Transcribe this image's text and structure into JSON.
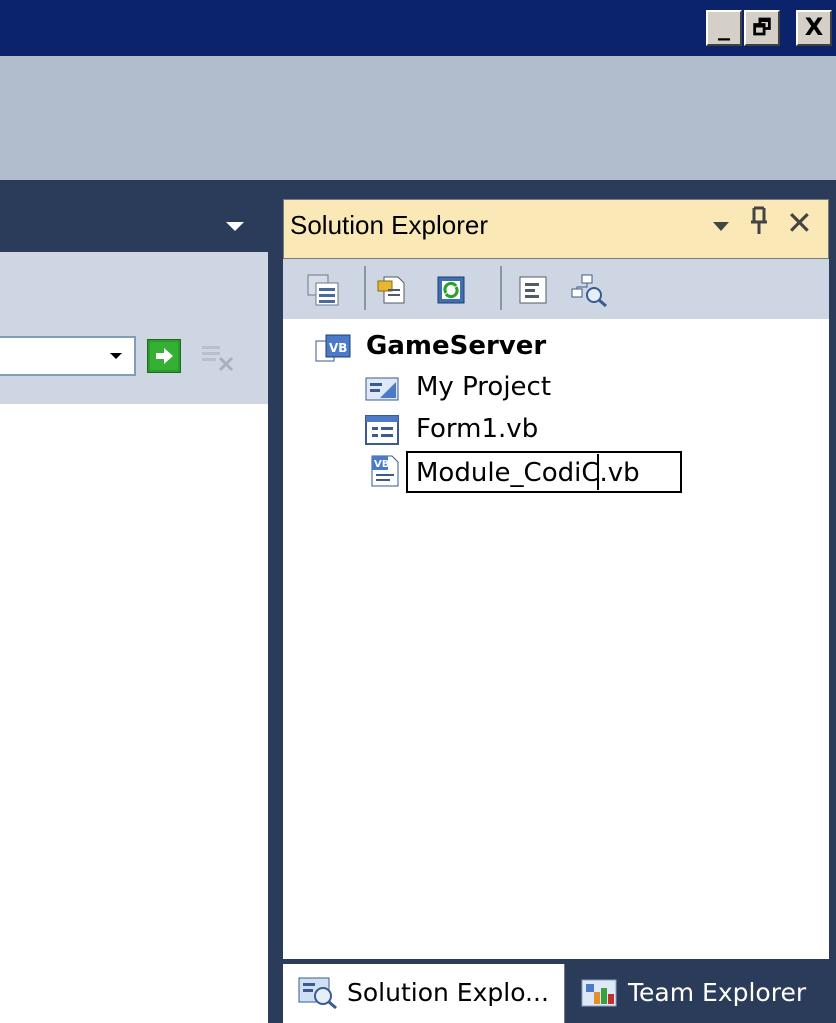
{
  "window": {
    "caption_buttons": {
      "minimize": "_",
      "restore": "🗗",
      "close": "X"
    }
  },
  "left_pane": {
    "combo_value": ""
  },
  "solution_explorer": {
    "title": "Solution Explorer",
    "pin_glyph": "ф",
    "close_glyph": "✕",
    "toolbar_icons": [
      "properties-icon",
      "show-all-files-icon",
      "refresh-icon",
      "view-code-icon",
      "class-diagram-icon"
    ],
    "tree": {
      "root": {
        "label": "GameServer",
        "icon": "vb-project-icon"
      },
      "children": [
        {
          "label": "My Project",
          "icon": "my-project-icon"
        },
        {
          "label": "Form1.vb",
          "icon": "form-icon"
        },
        {
          "label": "Module_CodiC",
          "suffix": ".vb",
          "icon": "vb-module-icon",
          "editing": true
        }
      ]
    },
    "bottom_tabs": [
      {
        "label": "Solution Explo...",
        "icon": "solution-explorer-icon",
        "active": true
      },
      {
        "label": "Team Explorer",
        "icon": "team-explorer-icon",
        "active": false
      }
    ]
  },
  "colors": {
    "title_bar": "#0b236a",
    "chrome": "#b1bccc",
    "panel_header": "#fae9b7",
    "dock_dark": "#2b3c5a"
  }
}
